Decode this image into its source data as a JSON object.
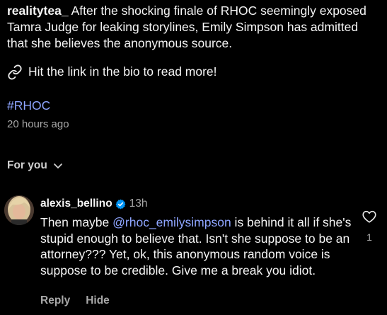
{
  "post": {
    "username": "realitytea_",
    "caption": "After the shocking finale of RHOC seemingly exposed Tamra Judge for leaking storylines, Emily Simpson has admitted that she believes the anonymous source.",
    "cta_text": "Hit the link in the bio to read more!",
    "hashtag": "#RHOC",
    "timestamp": "20 hours ago"
  },
  "comments_header": {
    "sort_label": "For you"
  },
  "comment": {
    "username": "alexis_bellino",
    "verified": true,
    "time": "13h",
    "text_before": "Then maybe ",
    "mention": "@rhoc_emilysimpson",
    "text_after": " is behind it all if she's stupid enough to believe that. Isn't she suppose to be an attorney??? Yet, ok, this anonymous random voice is suppose to be credible. Give me a break you idiot.",
    "like_count": "1",
    "reply_label": "Reply",
    "hide_label": "Hide"
  },
  "colors": {
    "background": "#000000",
    "text": "#f5f5f5",
    "link": "#8ea5ff",
    "muted": "#a8a8a8",
    "verified": "#0095f6"
  },
  "icons": [
    "link-icon",
    "chevron-down-icon",
    "verified-badge-icon",
    "heart-icon"
  ]
}
